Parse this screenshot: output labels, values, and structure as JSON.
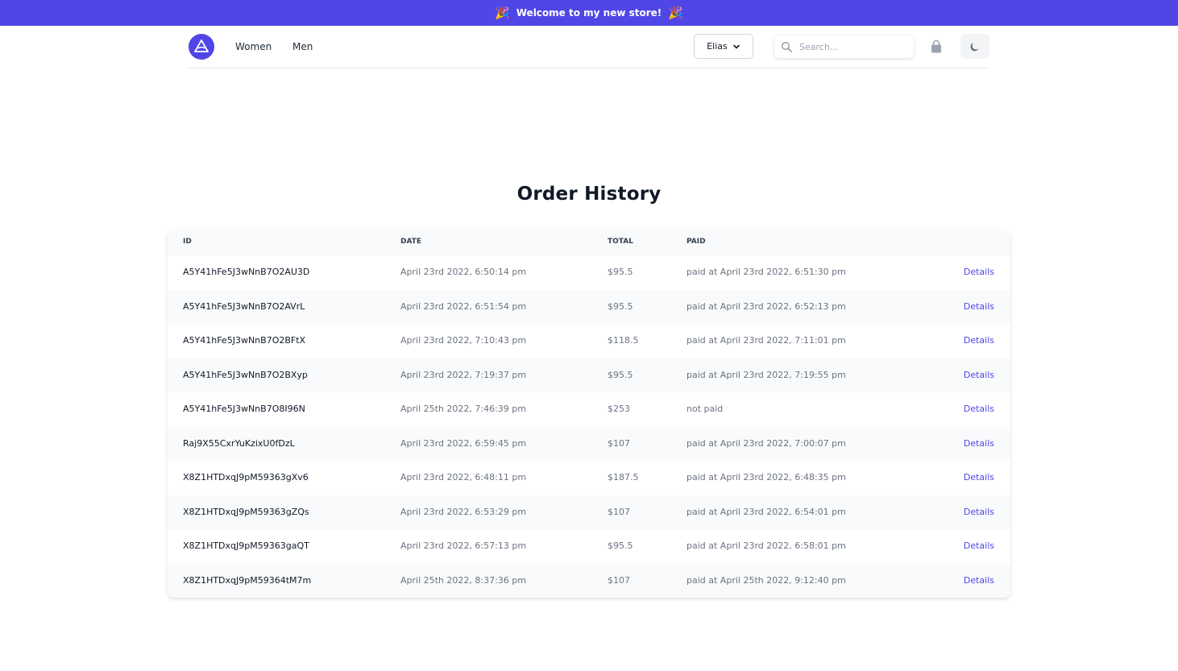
{
  "banner": {
    "text": "Welcome to my new store!",
    "confetti": "🎉"
  },
  "nav": {
    "logo_icon": "triangle-logo-icon",
    "links": [
      "Women",
      "Men"
    ],
    "user_label": "Elias",
    "search_placeholder": "Search...",
    "cart_icon": "shopping-bag-icon",
    "theme_icon": "moon-icon"
  },
  "page": {
    "title": "Order History"
  },
  "table": {
    "headers": {
      "id": "ID",
      "date": "DATE",
      "total": "TOTAL",
      "paid": "PAID"
    },
    "rows": [
      {
        "id": "A5Y41hFe5J3wNnB7O2AU3D",
        "date": "April 23rd 2022, 6:50:14 pm",
        "total": "$95.5",
        "paid": "paid at April 23rd 2022, 6:51:30 pm",
        "link": "Details"
      },
      {
        "id": "A5Y41hFe5J3wNnB7O2AVrL",
        "date": "April 23rd 2022, 6:51:54 pm",
        "total": "$95.5",
        "paid": "paid at April 23rd 2022, 6:52:13 pm",
        "link": "Details"
      },
      {
        "id": "A5Y41hFe5J3wNnB7O2BFtX",
        "date": "April 23rd 2022, 7:10:43 pm",
        "total": "$118.5",
        "paid": "paid at April 23rd 2022, 7:11:01 pm",
        "link": "Details"
      },
      {
        "id": "A5Y41hFe5J3wNnB7O2BXyp",
        "date": "April 23rd 2022, 7:19:37 pm",
        "total": "$95.5",
        "paid": "paid at April 23rd 2022, 7:19:55 pm",
        "link": "Details"
      },
      {
        "id": "A5Y41hFe5J3wNnB7O8I96N",
        "date": "April 25th 2022, 7:46:39 pm",
        "total": "$253",
        "paid": "not paid",
        "link": "Details"
      },
      {
        "id": "Raj9X55CxrYuKzixU0fDzL",
        "date": "April 23rd 2022, 6:59:45 pm",
        "total": "$107",
        "paid": "paid at April 23rd 2022, 7:00:07 pm",
        "link": "Details"
      },
      {
        "id": "X8Z1HTDxqJ9pM59363gXv6",
        "date": "April 23rd 2022, 6:48:11 pm",
        "total": "$187.5",
        "paid": "paid at April 23rd 2022, 6:48:35 pm",
        "link": "Details"
      },
      {
        "id": "X8Z1HTDxqJ9pM59363gZQs",
        "date": "April 23rd 2022, 6:53:29 pm",
        "total": "$107",
        "paid": "paid at April 23rd 2022, 6:54:01 pm",
        "link": "Details"
      },
      {
        "id": "X8Z1HTDxqJ9pM59363gaQT",
        "date": "April 23rd 2022, 6:57:13 pm",
        "total": "$95.5",
        "paid": "paid at April 23rd 2022, 6:58:01 pm",
        "link": "Details"
      },
      {
        "id": "X8Z1HTDxqJ9pM59364tM7m",
        "date": "April 25th 2022, 8:37:36 pm",
        "total": "$107",
        "paid": "paid at April 25th 2022, 9:12:40 pm",
        "link": "Details"
      }
    ]
  },
  "colors": {
    "accent": "#4f46e5",
    "muted_text": "#6b7280",
    "row_alt": "#f9fafb"
  }
}
